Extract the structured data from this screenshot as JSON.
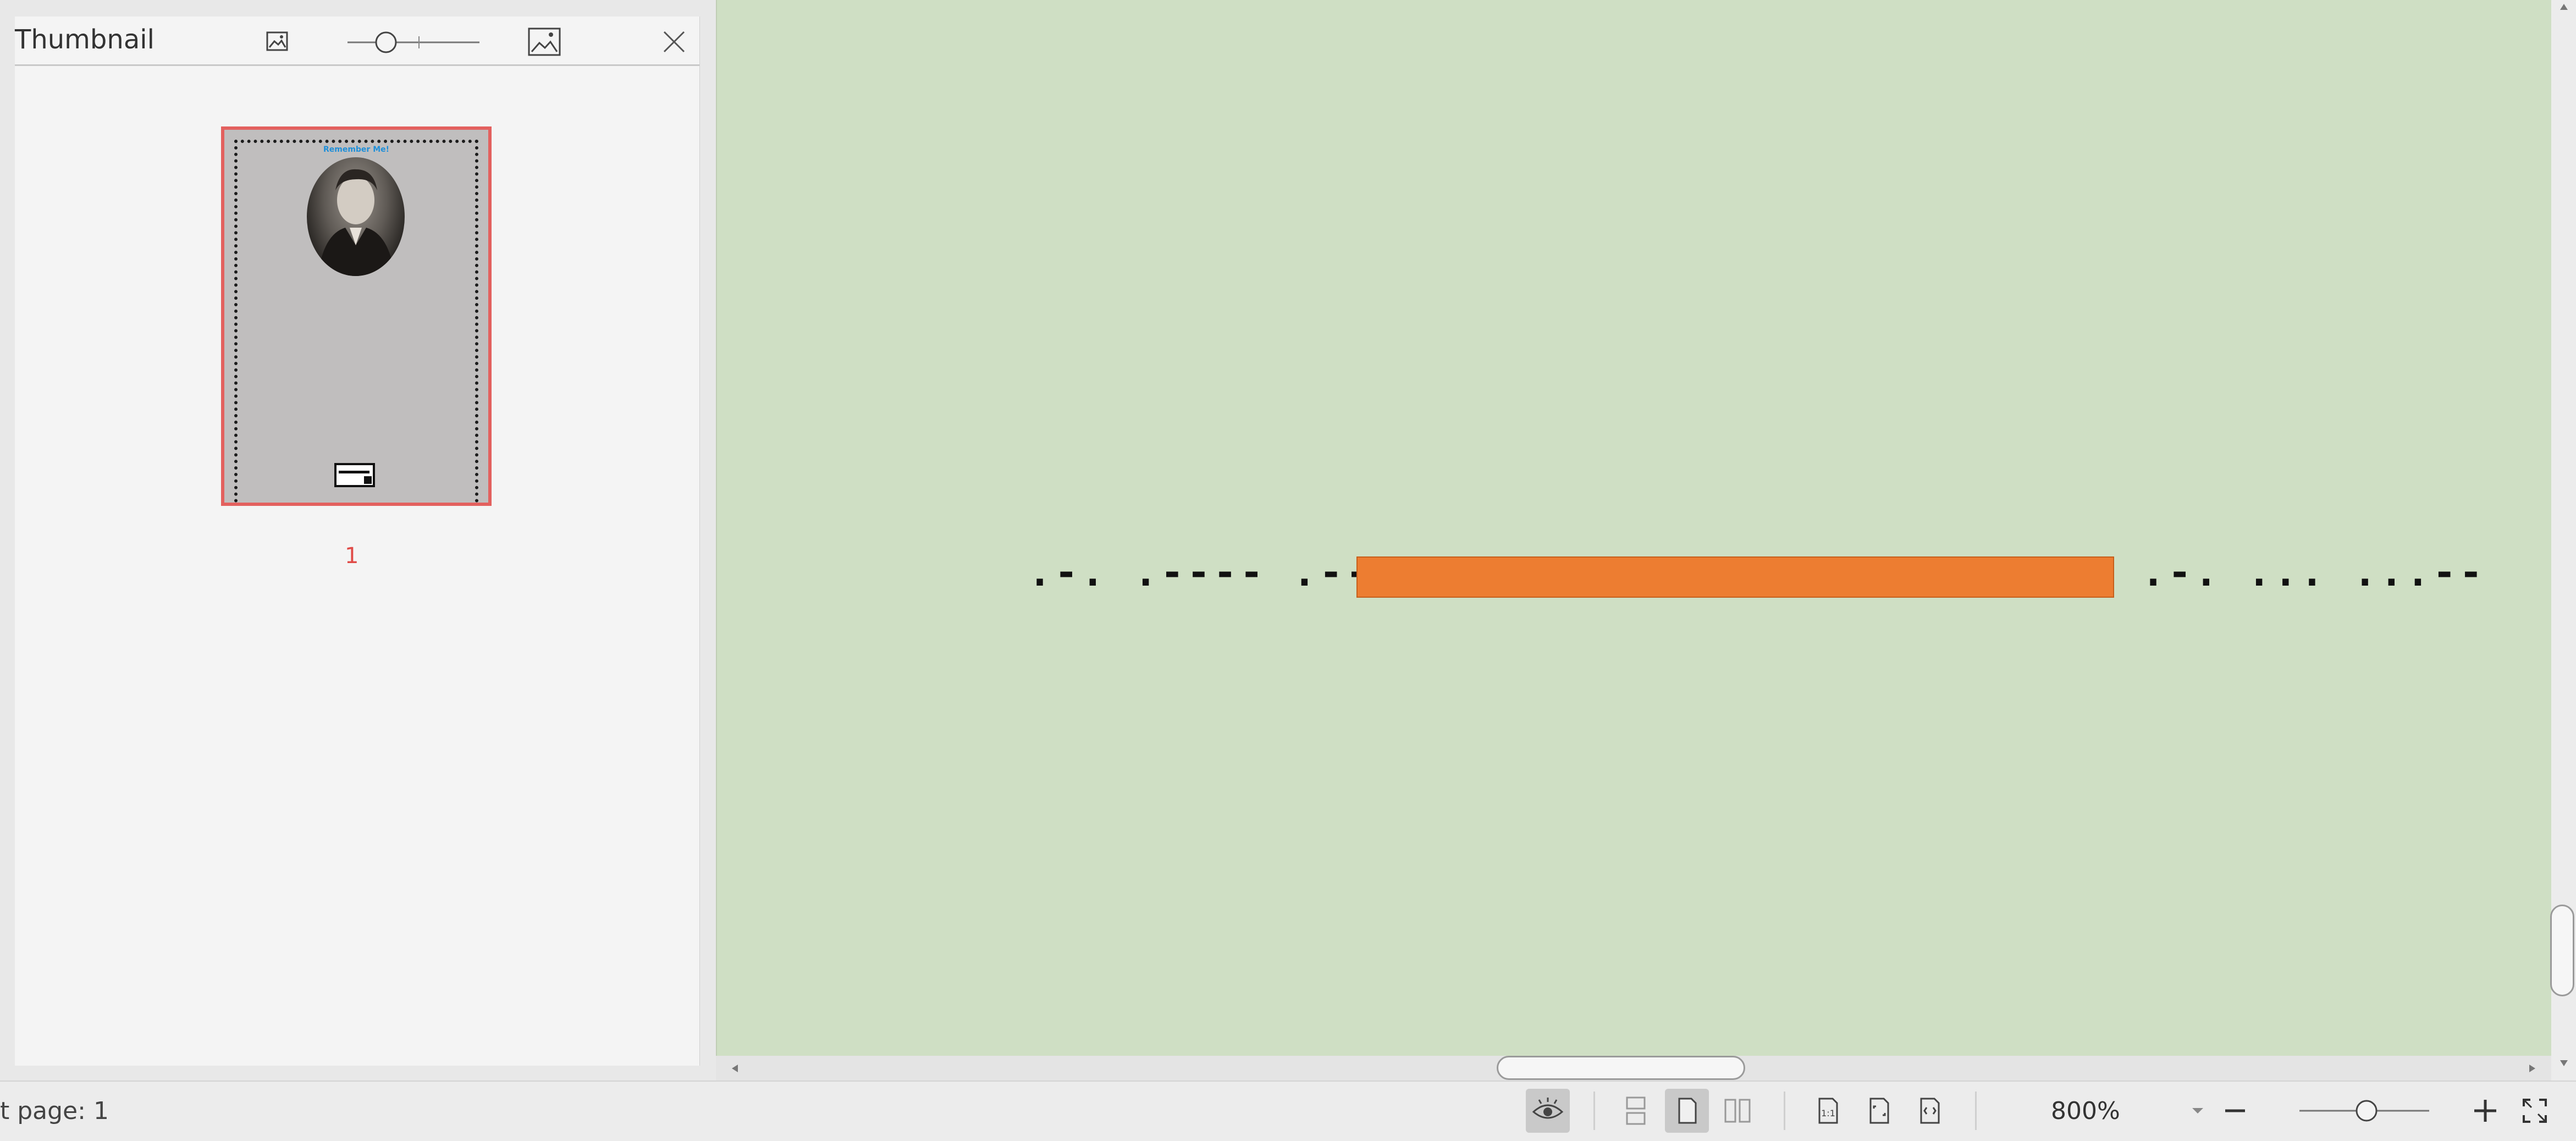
{
  "thumbnail_panel": {
    "title": "Thumbnail",
    "page_title": "Remember Me!",
    "page_number": "1",
    "icons": [
      "small-image-icon",
      "zoom-slider",
      "large-image-icon",
      "close-icon"
    ]
  },
  "canvas": {
    "morse_left": ".-. .---- .--.",
    "morse_right": ".-. ... ...--",
    "redaction_color": "#ed7d31",
    "background_color": "#cfdfc4"
  },
  "statusbar": {
    "page_label": "t page: 1",
    "zoom": "800%",
    "zoom_slider_level": 0.55,
    "icons": [
      "view-eye-icon",
      "single-page-continuous-icon",
      "single-page-icon",
      "two-page-icon",
      "actual-size-icon",
      "fit-page-icon",
      "fit-width-icon",
      "zoom-out-icon",
      "zoom-in-icon",
      "fullscreen-icon"
    ]
  }
}
